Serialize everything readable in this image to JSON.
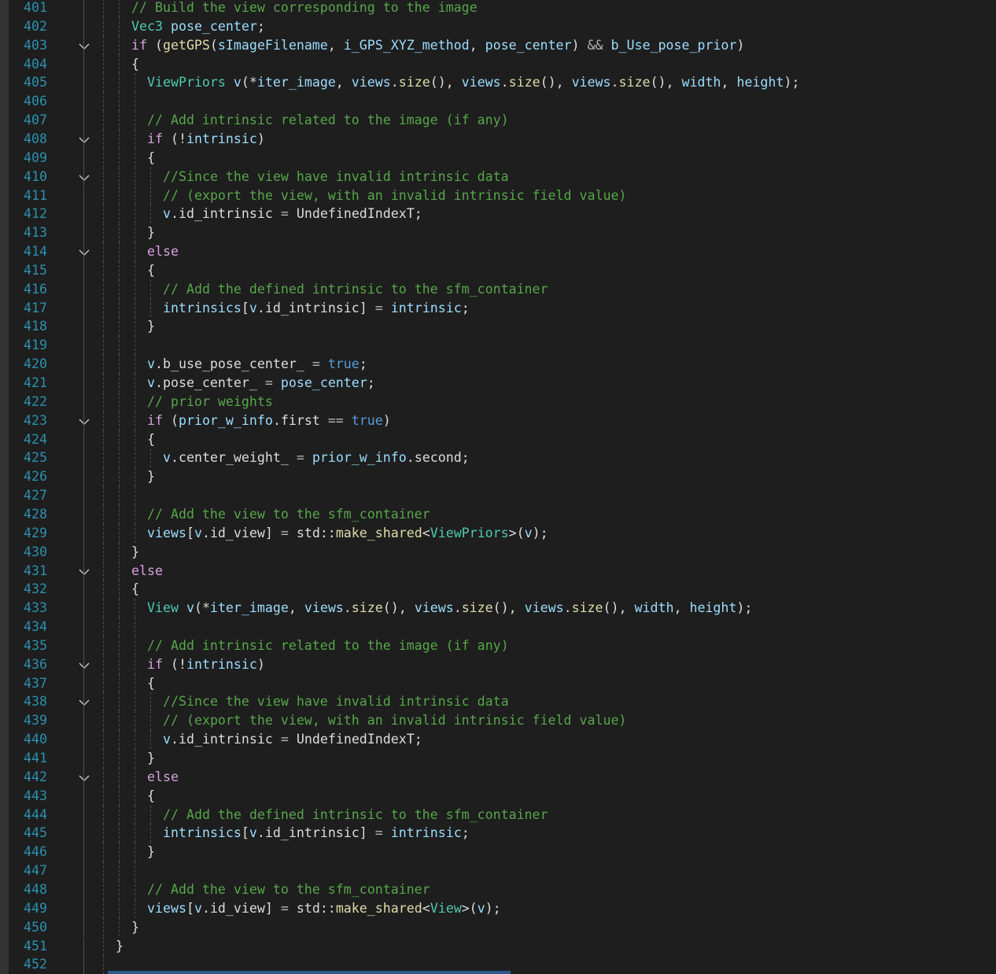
{
  "editor": {
    "language": "C++",
    "colors": {
      "background": "#1e1e1e",
      "line_number": "#2b91af",
      "comment": "#57a64a",
      "keyword": "#d8a0df",
      "bool_keyword": "#569cd6",
      "type": "#4ec9b0",
      "variable": "#9cdcfe",
      "function": "#dcdcaa",
      "plain": "#dcdcdc"
    },
    "lines": [
      {
        "n": "401",
        "fold": false,
        "indent": 1,
        "tokens": [
          [
            "cm",
            "// Build the view corresponding to the image"
          ]
        ]
      },
      {
        "n": "402",
        "fold": false,
        "indent": 1,
        "tokens": [
          [
            "ty",
            "Vec3"
          ],
          [
            "plain",
            " "
          ],
          [
            "var",
            "pose_center"
          ],
          [
            "plain",
            ";"
          ]
        ]
      },
      {
        "n": "403",
        "fold": true,
        "indent": 1,
        "tokens": [
          [
            "kw",
            "if"
          ],
          [
            "plain",
            " ("
          ],
          [
            "fn",
            "getGPS"
          ],
          [
            "plain",
            "("
          ],
          [
            "var",
            "sImageFilename"
          ],
          [
            "plain",
            ", "
          ],
          [
            "var",
            "i_GPS_XYZ_method"
          ],
          [
            "plain",
            ", "
          ],
          [
            "var",
            "pose_center"
          ],
          [
            "plain",
            ") "
          ],
          [
            "op",
            "&&"
          ],
          [
            "plain",
            " "
          ],
          [
            "var",
            "b_Use_pose_prior"
          ],
          [
            "plain",
            ")"
          ]
        ]
      },
      {
        "n": "404",
        "fold": false,
        "indent": 1,
        "tokens": [
          [
            "plain",
            "{"
          ]
        ]
      },
      {
        "n": "405",
        "fold": false,
        "indent": 2,
        "tokens": [
          [
            "ty",
            "ViewPriors"
          ],
          [
            "plain",
            " "
          ],
          [
            "var",
            "v"
          ],
          [
            "plain",
            "(*"
          ],
          [
            "var",
            "iter_image"
          ],
          [
            "plain",
            ", "
          ],
          [
            "var",
            "views"
          ],
          [
            "plain",
            "."
          ],
          [
            "fn",
            "size"
          ],
          [
            "plain",
            "(), "
          ],
          [
            "var",
            "views"
          ],
          [
            "plain",
            "."
          ],
          [
            "fn",
            "size"
          ],
          [
            "plain",
            "(), "
          ],
          [
            "var",
            "views"
          ],
          [
            "plain",
            "."
          ],
          [
            "fn",
            "size"
          ],
          [
            "plain",
            "(), "
          ],
          [
            "var",
            "width"
          ],
          [
            "plain",
            ", "
          ],
          [
            "var",
            "height"
          ],
          [
            "plain",
            ");"
          ]
        ]
      },
      {
        "n": "406",
        "fold": false,
        "indent": 2,
        "tokens": []
      },
      {
        "n": "407",
        "fold": false,
        "indent": 2,
        "tokens": [
          [
            "cm",
            "// Add intrinsic related to the image (if any)"
          ]
        ]
      },
      {
        "n": "408",
        "fold": true,
        "indent": 2,
        "tokens": [
          [
            "kw",
            "if"
          ],
          [
            "plain",
            " (!"
          ],
          [
            "var",
            "intrinsic"
          ],
          [
            "plain",
            ")"
          ]
        ]
      },
      {
        "n": "409",
        "fold": false,
        "indent": 2,
        "tokens": [
          [
            "plain",
            "{"
          ]
        ]
      },
      {
        "n": "410",
        "fold": true,
        "indent": 3,
        "tokens": [
          [
            "cm",
            "//Since the view have invalid intrinsic data"
          ]
        ]
      },
      {
        "n": "411",
        "fold": false,
        "indent": 3,
        "tokens": [
          [
            "cm",
            "// (export the view, with an invalid intrinsic field value)"
          ]
        ]
      },
      {
        "n": "412",
        "fold": false,
        "indent": 3,
        "tokens": [
          [
            "var",
            "v"
          ],
          [
            "plain",
            "."
          ],
          [
            "plain",
            "id_intrinsic"
          ],
          [
            "plain",
            " "
          ],
          [
            "op",
            "="
          ],
          [
            "plain",
            " UndefinedIndexT;"
          ]
        ]
      },
      {
        "n": "413",
        "fold": false,
        "indent": 2,
        "tokens": [
          [
            "plain",
            "}"
          ]
        ]
      },
      {
        "n": "414",
        "fold": true,
        "indent": 2,
        "tokens": [
          [
            "kw",
            "else"
          ]
        ]
      },
      {
        "n": "415",
        "fold": false,
        "indent": 2,
        "tokens": [
          [
            "plain",
            "{"
          ]
        ]
      },
      {
        "n": "416",
        "fold": false,
        "indent": 3,
        "tokens": [
          [
            "cm",
            "// Add the defined intrinsic to the sfm_container"
          ]
        ]
      },
      {
        "n": "417",
        "fold": false,
        "indent": 3,
        "tokens": [
          [
            "var",
            "intrinsics"
          ],
          [
            "plain",
            "["
          ],
          [
            "var",
            "v"
          ],
          [
            "plain",
            ".id_intrinsic] "
          ],
          [
            "op",
            "="
          ],
          [
            "plain",
            " "
          ],
          [
            "var",
            "intrinsic"
          ],
          [
            "plain",
            ";"
          ]
        ]
      },
      {
        "n": "418",
        "fold": false,
        "indent": 2,
        "tokens": [
          [
            "plain",
            "}"
          ]
        ]
      },
      {
        "n": "419",
        "fold": false,
        "indent": 2,
        "tokens": []
      },
      {
        "n": "420",
        "fold": false,
        "indent": 2,
        "tokens": [
          [
            "var",
            "v"
          ],
          [
            "plain",
            ".b_use_pose_center_ "
          ],
          [
            "op",
            "="
          ],
          [
            "plain",
            " "
          ],
          [
            "kwb",
            "true"
          ],
          [
            "plain",
            ";"
          ]
        ]
      },
      {
        "n": "421",
        "fold": false,
        "indent": 2,
        "tokens": [
          [
            "var",
            "v"
          ],
          [
            "plain",
            ".pose_center_ "
          ],
          [
            "op",
            "="
          ],
          [
            "plain",
            " "
          ],
          [
            "var",
            "pose_center"
          ],
          [
            "plain",
            ";"
          ]
        ]
      },
      {
        "n": "422",
        "fold": false,
        "indent": 2,
        "tokens": [
          [
            "cm",
            "// prior weights"
          ]
        ]
      },
      {
        "n": "423",
        "fold": true,
        "indent": 2,
        "tokens": [
          [
            "kw",
            "if"
          ],
          [
            "plain",
            " ("
          ],
          [
            "var",
            "prior_w_info"
          ],
          [
            "plain",
            ".first "
          ],
          [
            "op",
            "=="
          ],
          [
            "plain",
            " "
          ],
          [
            "kwb",
            "true"
          ],
          [
            "plain",
            ")"
          ]
        ]
      },
      {
        "n": "424",
        "fold": false,
        "indent": 2,
        "tokens": [
          [
            "plain",
            "{"
          ]
        ]
      },
      {
        "n": "425",
        "fold": false,
        "indent": 3,
        "tokens": [
          [
            "var",
            "v"
          ],
          [
            "plain",
            ".center_weight_ "
          ],
          [
            "op",
            "="
          ],
          [
            "plain",
            " "
          ],
          [
            "var",
            "prior_w_info"
          ],
          [
            "plain",
            ".second;"
          ]
        ]
      },
      {
        "n": "426",
        "fold": false,
        "indent": 2,
        "tokens": [
          [
            "plain",
            "}"
          ]
        ]
      },
      {
        "n": "427",
        "fold": false,
        "indent": 2,
        "tokens": []
      },
      {
        "n": "428",
        "fold": false,
        "indent": 2,
        "tokens": [
          [
            "cm",
            "// Add the view to the sfm_container"
          ]
        ]
      },
      {
        "n": "429",
        "fold": false,
        "indent": 2,
        "tokens": [
          [
            "var",
            "views"
          ],
          [
            "plain",
            "["
          ],
          [
            "var",
            "v"
          ],
          [
            "plain",
            ".id_view] "
          ],
          [
            "op",
            "="
          ],
          [
            "plain",
            " std::"
          ],
          [
            "fn",
            "make_shared"
          ],
          [
            "plain",
            "<"
          ],
          [
            "ty",
            "ViewPriors"
          ],
          [
            "plain",
            ">("
          ],
          [
            "var",
            "v"
          ],
          [
            "plain",
            ");"
          ]
        ]
      },
      {
        "n": "430",
        "fold": false,
        "indent": 1,
        "tokens": [
          [
            "plain",
            "}"
          ]
        ]
      },
      {
        "n": "431",
        "fold": true,
        "indent": 1,
        "tokens": [
          [
            "kw",
            "else"
          ]
        ]
      },
      {
        "n": "432",
        "fold": false,
        "indent": 1,
        "tokens": [
          [
            "plain",
            "{"
          ]
        ]
      },
      {
        "n": "433",
        "fold": false,
        "indent": 2,
        "tokens": [
          [
            "ty",
            "View"
          ],
          [
            "plain",
            " "
          ],
          [
            "var",
            "v"
          ],
          [
            "plain",
            "(*"
          ],
          [
            "var",
            "iter_image"
          ],
          [
            "plain",
            ", "
          ],
          [
            "var",
            "views"
          ],
          [
            "plain",
            "."
          ],
          [
            "fn",
            "size"
          ],
          [
            "plain",
            "(), "
          ],
          [
            "var",
            "views"
          ],
          [
            "plain",
            "."
          ],
          [
            "fn",
            "size"
          ],
          [
            "plain",
            "(), "
          ],
          [
            "var",
            "views"
          ],
          [
            "plain",
            "."
          ],
          [
            "fn",
            "size"
          ],
          [
            "plain",
            "(), "
          ],
          [
            "var",
            "width"
          ],
          [
            "plain",
            ", "
          ],
          [
            "var",
            "height"
          ],
          [
            "plain",
            ");"
          ]
        ]
      },
      {
        "n": "434",
        "fold": false,
        "indent": 2,
        "tokens": []
      },
      {
        "n": "435",
        "fold": false,
        "indent": 2,
        "tokens": [
          [
            "cm",
            "// Add intrinsic related to the image (if any)"
          ]
        ]
      },
      {
        "n": "436",
        "fold": true,
        "indent": 2,
        "tokens": [
          [
            "kw",
            "if"
          ],
          [
            "plain",
            " (!"
          ],
          [
            "var",
            "intrinsic"
          ],
          [
            "plain",
            ")"
          ]
        ]
      },
      {
        "n": "437",
        "fold": false,
        "indent": 2,
        "tokens": [
          [
            "plain",
            "{"
          ]
        ]
      },
      {
        "n": "438",
        "fold": true,
        "indent": 3,
        "tokens": [
          [
            "cm",
            "//Since the view have invalid intrinsic data"
          ]
        ]
      },
      {
        "n": "439",
        "fold": false,
        "indent": 3,
        "tokens": [
          [
            "cm",
            "// (export the view, with an invalid intrinsic field value)"
          ]
        ]
      },
      {
        "n": "440",
        "fold": false,
        "indent": 3,
        "tokens": [
          [
            "var",
            "v"
          ],
          [
            "plain",
            "."
          ],
          [
            "plain",
            "id_intrinsic"
          ],
          [
            "plain",
            " "
          ],
          [
            "op",
            "="
          ],
          [
            "plain",
            " UndefinedIndexT;"
          ]
        ]
      },
      {
        "n": "441",
        "fold": false,
        "indent": 2,
        "tokens": [
          [
            "plain",
            "}"
          ]
        ]
      },
      {
        "n": "442",
        "fold": true,
        "indent": 2,
        "tokens": [
          [
            "kw",
            "else"
          ]
        ]
      },
      {
        "n": "443",
        "fold": false,
        "indent": 2,
        "tokens": [
          [
            "plain",
            "{"
          ]
        ]
      },
      {
        "n": "444",
        "fold": false,
        "indent": 3,
        "tokens": [
          [
            "cm",
            "// Add the defined intrinsic to the sfm_container"
          ]
        ]
      },
      {
        "n": "445",
        "fold": false,
        "indent": 3,
        "tokens": [
          [
            "var",
            "intrinsics"
          ],
          [
            "plain",
            "["
          ],
          [
            "var",
            "v"
          ],
          [
            "plain",
            ".id_intrinsic] "
          ],
          [
            "op",
            "="
          ],
          [
            "plain",
            " "
          ],
          [
            "var",
            "intrinsic"
          ],
          [
            "plain",
            ";"
          ]
        ]
      },
      {
        "n": "446",
        "fold": false,
        "indent": 2,
        "tokens": [
          [
            "plain",
            "}"
          ]
        ]
      },
      {
        "n": "447",
        "fold": false,
        "indent": 2,
        "tokens": []
      },
      {
        "n": "448",
        "fold": false,
        "indent": 2,
        "tokens": [
          [
            "cm",
            "// Add the view to the sfm_container"
          ]
        ]
      },
      {
        "n": "449",
        "fold": false,
        "indent": 2,
        "tokens": [
          [
            "var",
            "views"
          ],
          [
            "plain",
            "["
          ],
          [
            "var",
            "v"
          ],
          [
            "plain",
            ".id_view] "
          ],
          [
            "op",
            "="
          ],
          [
            "plain",
            " std::"
          ],
          [
            "fn",
            "make_shared"
          ],
          [
            "plain",
            "<"
          ],
          [
            "ty",
            "View"
          ],
          [
            "plain",
            ">("
          ],
          [
            "var",
            "v"
          ],
          [
            "plain",
            ");"
          ]
        ]
      },
      {
        "n": "450",
        "fold": false,
        "indent": 1,
        "tokens": [
          [
            "plain",
            "}"
          ]
        ]
      },
      {
        "n": "451",
        "fold": false,
        "indent": 0,
        "tokens": [
          [
            "plain",
            "}"
          ]
        ]
      },
      {
        "n": "452",
        "fold": false,
        "indent": 0,
        "tokens": []
      }
    ]
  }
}
